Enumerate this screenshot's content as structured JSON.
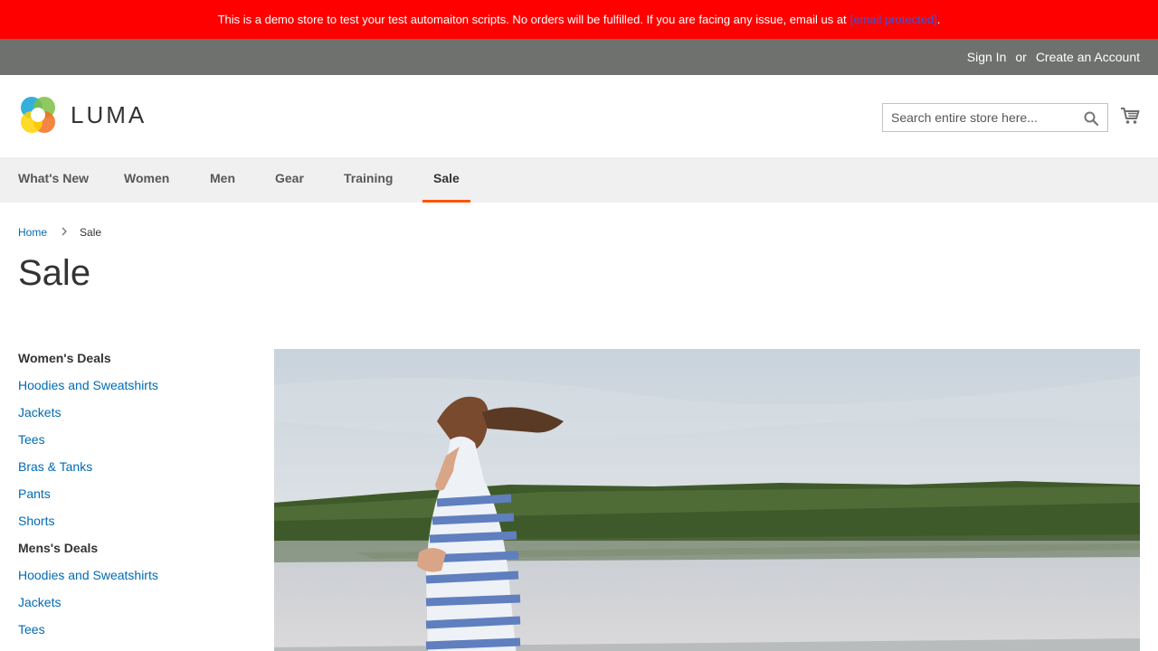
{
  "notice": {
    "text": "This is a demo store to test your test automaiton scripts. No orders will be fulfilled. If you are facing any issue, email us at",
    "email": "[email protected]",
    "end": "."
  },
  "panel": {
    "sign_in": "Sign In",
    "or": "or",
    "create_account": "Create an Account"
  },
  "header": {
    "logo_text": "LUMA",
    "search_placeholder": "Search entire store here...",
    "icons": {
      "search": "search-icon",
      "cart": "cart-icon"
    }
  },
  "nav": {
    "items": [
      {
        "label": "What's New"
      },
      {
        "label": "Women"
      },
      {
        "label": "Men"
      },
      {
        "label": "Gear"
      },
      {
        "label": "Training"
      },
      {
        "label": "Sale"
      }
    ],
    "active": "Sale"
  },
  "breadcrumb": {
    "home": "Home",
    "current": "Sale"
  },
  "page_title": "Sale",
  "sidebar": {
    "womens": {
      "title": "Women's Deals",
      "links": [
        "Hoodies and Sweatshirts",
        "Jackets",
        "Tees",
        "Bras & Tanks",
        "Pants",
        "Shorts"
      ]
    },
    "mens": {
      "title": "Mens's Deals",
      "links": [
        "Hoodies and Sweatshirts",
        "Jackets",
        "Tees"
      ]
    }
  },
  "colors": {
    "notice_bg": "#ff0000",
    "panel_bg": "#6e716e",
    "nav_bg": "#f0f0f0",
    "link": "#006bb4",
    "accent": "#ff5501"
  }
}
